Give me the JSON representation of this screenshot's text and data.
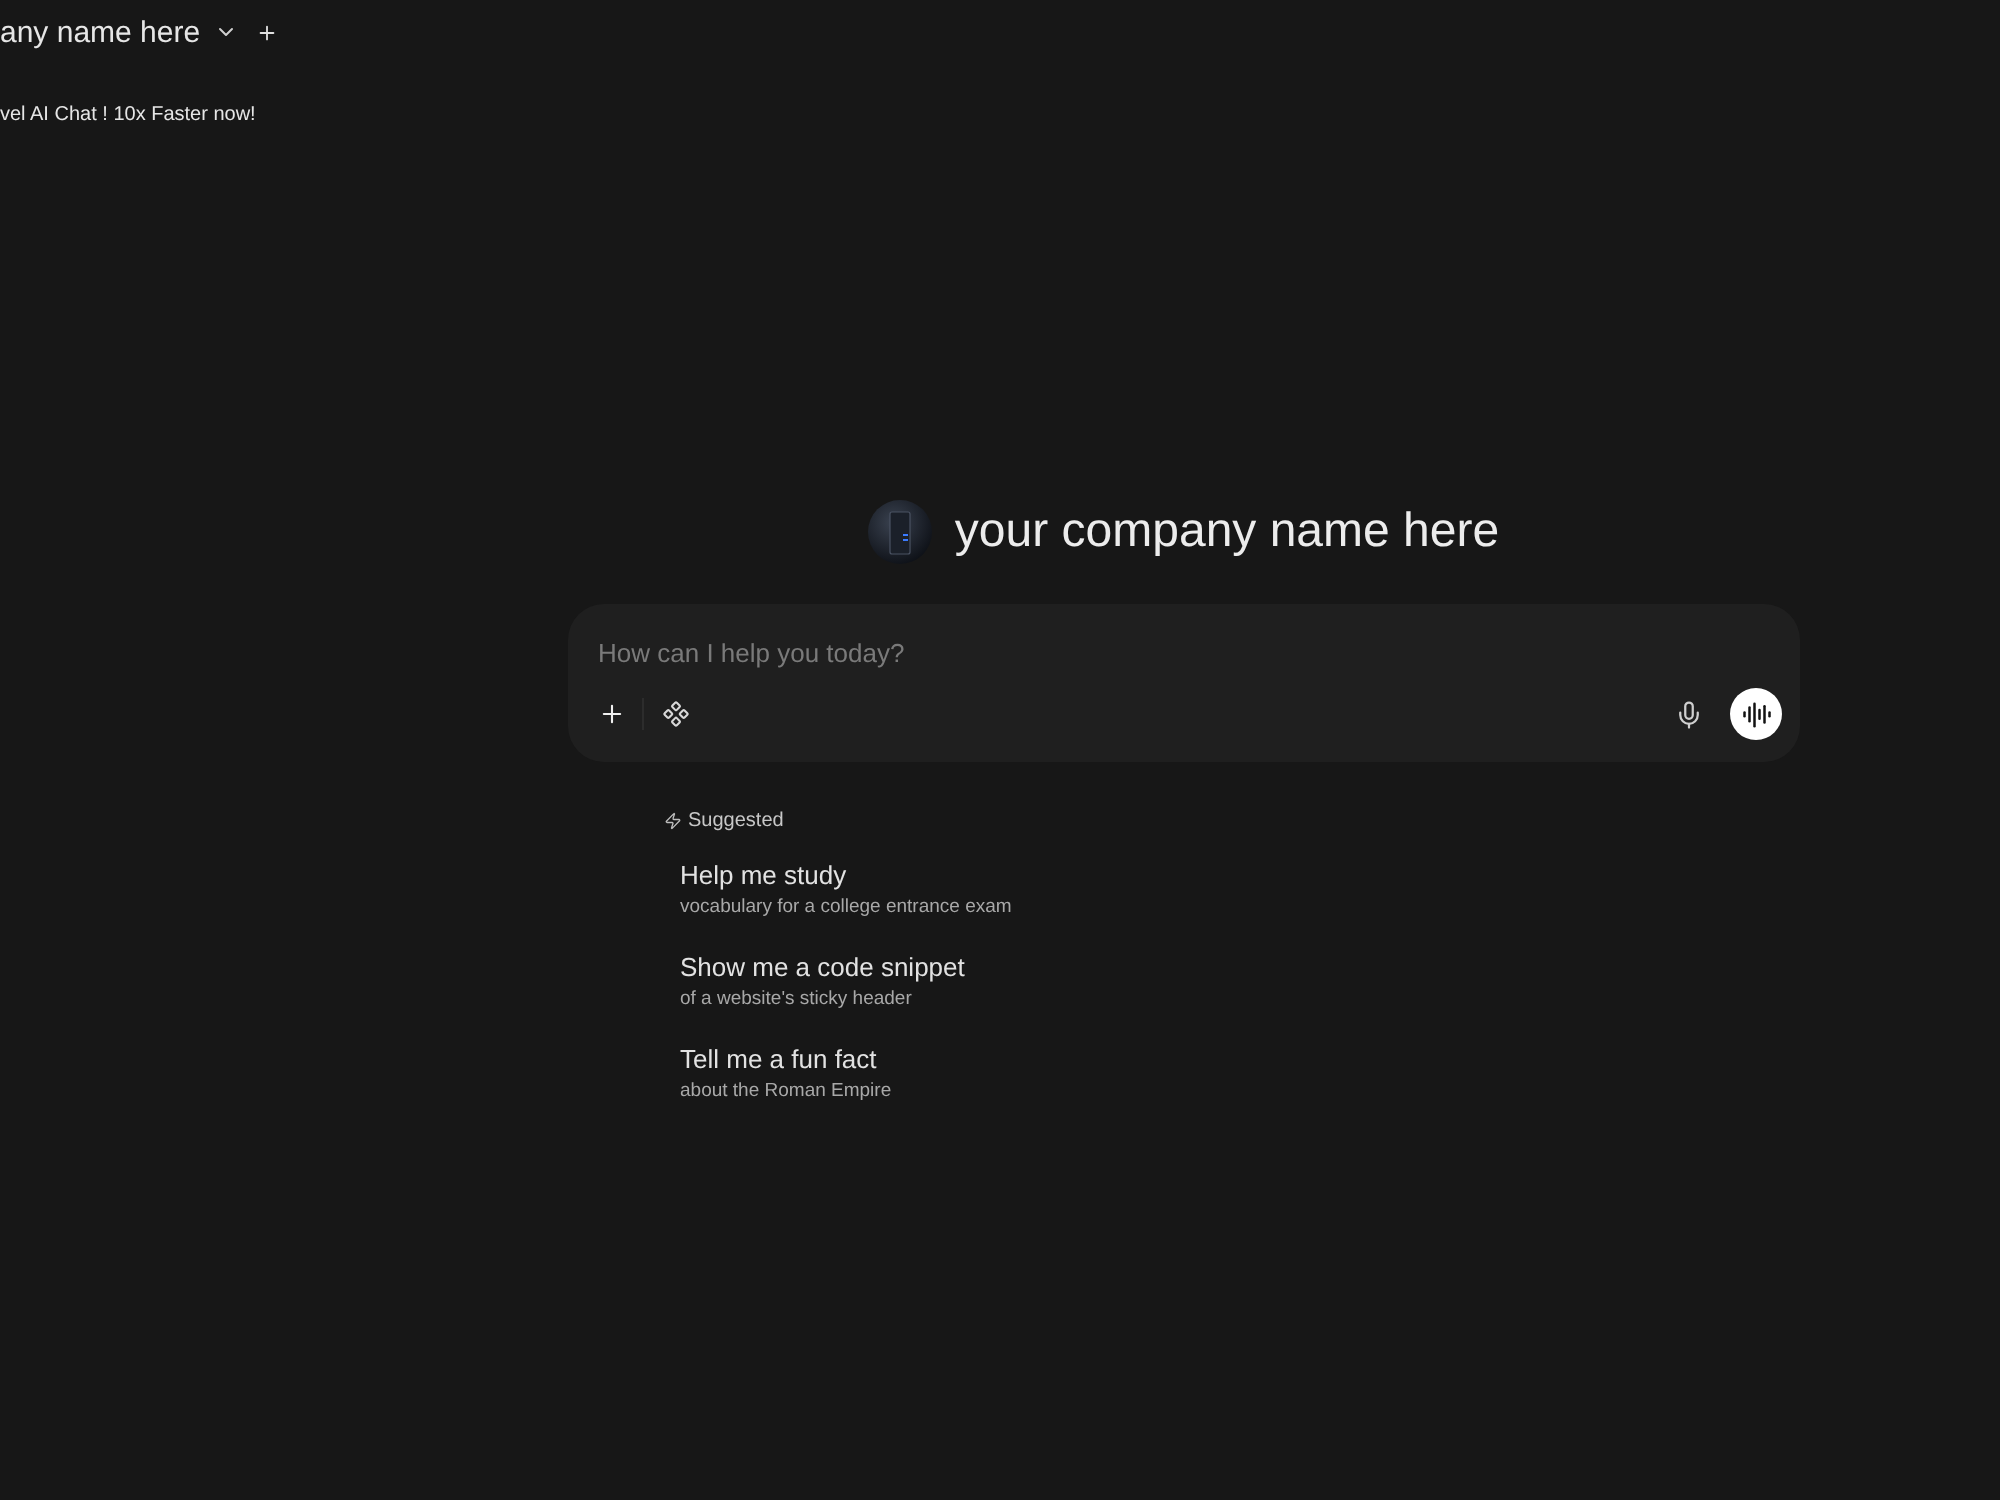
{
  "header": {
    "title": "any name here",
    "tagline": "vel AI Chat ! 10x Faster now!"
  },
  "brand": {
    "name": "your company name here"
  },
  "composer": {
    "placeholder": "How can I help you today?"
  },
  "suggestions": {
    "heading": "Suggested",
    "items": [
      {
        "title": "Help me study",
        "subtitle": "vocabulary for a college entrance exam"
      },
      {
        "title": "Show me a code snippet",
        "subtitle": "of a website's sticky header"
      },
      {
        "title": "Tell me a fun fact",
        "subtitle": "about the Roman Empire"
      }
    ]
  }
}
